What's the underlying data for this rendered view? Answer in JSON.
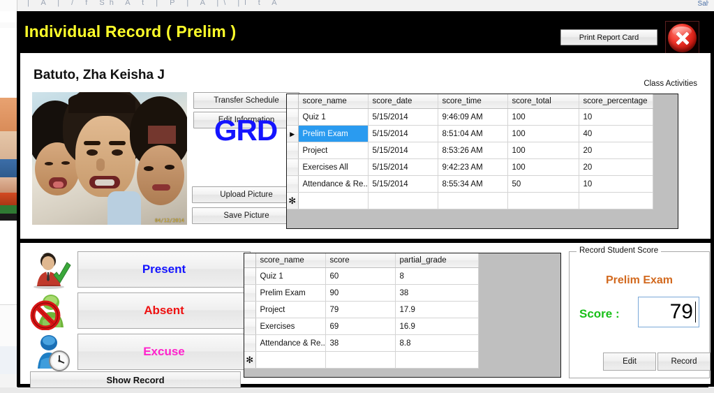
{
  "background": {
    "top_ghost_text": "g  | A  |     /       f          Sh     A   t   |   P          | A  |\\   |l     t   A",
    "top_right_text": "Salv"
  },
  "window": {
    "title": "Individual Record ( Prelim )",
    "print_button": "Print Report Card",
    "close_icon": "close-circle-icon"
  },
  "student": {
    "name": "Batuto, Zha Keisha J",
    "photo_date": "04/12/2014",
    "grd_label": "GRD"
  },
  "top_buttons": {
    "transfer_schedule": "Transfer Schedule",
    "edit_information": "Edit Information",
    "upload_picture": "Upload Picture",
    "save_picture": "Save Picture"
  },
  "class_activities": {
    "label": "Class Activities",
    "columns": [
      "score_name",
      "score_date",
      "score_time",
      "score_total",
      "score_percentage"
    ],
    "rows": [
      {
        "selected": false,
        "marker": "",
        "score_name": "Quiz 1",
        "score_date": "5/15/2014",
        "score_time": "9:46:09 AM",
        "score_total": "100",
        "score_percentage": "10"
      },
      {
        "selected": true,
        "marker": "▶",
        "score_name": "Prelim Exam",
        "score_date": "5/15/2014",
        "score_time": "8:51:04 AM",
        "score_total": "100",
        "score_percentage": "40"
      },
      {
        "selected": false,
        "marker": "",
        "score_name": "Project",
        "score_date": "5/15/2014",
        "score_time": "8:53:26 AM",
        "score_total": "100",
        "score_percentage": "20"
      },
      {
        "selected": false,
        "marker": "",
        "score_name": "Exercises All",
        "score_date": "5/15/2014",
        "score_time": "9:42:23 AM",
        "score_total": "100",
        "score_percentage": "20"
      },
      {
        "selected": false,
        "marker": "",
        "score_name": "Attendance & Re...",
        "score_date": "5/15/2014",
        "score_time": "8:55:34 AM",
        "score_total": "50",
        "score_percentage": "10"
      }
    ],
    "new_row_marker": "✻"
  },
  "attendance": {
    "items": [
      {
        "label": "Present",
        "color": "#1414ff",
        "icon": "person-check-icon"
      },
      {
        "label": "Absent",
        "color": "#ee1111",
        "icon": "person-blocked-icon"
      },
      {
        "label": "Excuse",
        "color": "#ff22cc",
        "icon": "person-clock-icon"
      }
    ],
    "show_record": "Show Record"
  },
  "student_scores": {
    "columns": [
      "score_name",
      "score",
      "partial_grade"
    ],
    "rows": [
      {
        "score_name": "Quiz 1",
        "score": "60",
        "partial_grade": "8"
      },
      {
        "score_name": "Prelim Exam",
        "score": "90",
        "partial_grade": "38"
      },
      {
        "score_name": "Project",
        "score": "79",
        "partial_grade": "17.9"
      },
      {
        "score_name": "Exercises",
        "score": "69",
        "partial_grade": "16.9"
      },
      {
        "score_name": "Attendance & Re...",
        "score": "38",
        "partial_grade": "8.8"
      }
    ],
    "new_row_marker": "✻"
  },
  "record_score": {
    "group_title": "Record Student Score",
    "exam_name": "Prelim Exam",
    "score_label": "Score :",
    "score_value": "79",
    "edit_button": "Edit",
    "record_button": "Record"
  }
}
